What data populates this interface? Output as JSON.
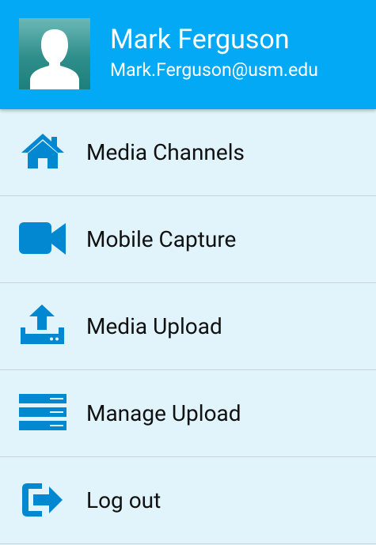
{
  "colors": {
    "header_bg": "#03a9f4",
    "menu_bg": "#e1f3fb",
    "icon": "#0288d1",
    "divider": "#c5d3d9"
  },
  "profile": {
    "name": "Mark Ferguson",
    "email": "Mark.Ferguson@usm.edu",
    "avatar_icon": "user-silhouette-icon"
  },
  "menu": {
    "items": [
      {
        "label": "Media Channels",
        "icon": "home-icon"
      },
      {
        "label": "Mobile Capture",
        "icon": "video-camera-icon"
      },
      {
        "label": "Media Upload",
        "icon": "upload-icon"
      },
      {
        "label": "Manage Upload",
        "icon": "server-list-icon"
      },
      {
        "label": "Log out",
        "icon": "logout-icon"
      }
    ]
  }
}
